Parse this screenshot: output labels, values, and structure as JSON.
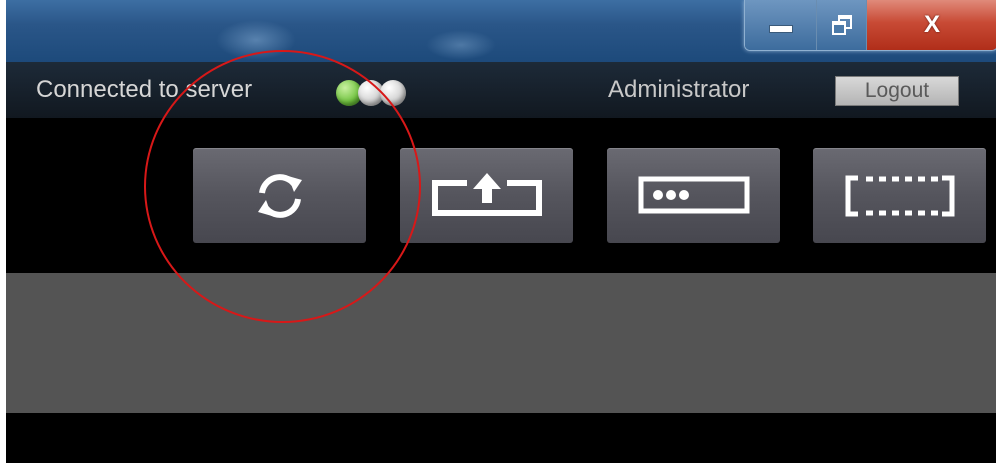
{
  "window": {
    "controls": {
      "minimize_icon": "minimize-icon",
      "restore_icon": "restore-icon",
      "close_label": "X"
    }
  },
  "status_bar": {
    "connection_text": "Connected to server",
    "indicators": [
      "green",
      "grey",
      "grey"
    ],
    "user_label": "Administrator",
    "logout_label": "Logout"
  },
  "toolbar": {
    "buttons": [
      {
        "icon": "refresh-icon"
      },
      {
        "icon": "upload-frame-icon"
      },
      {
        "icon": "dots-frame-icon"
      },
      {
        "icon": "dashed-frame-icon"
      }
    ]
  },
  "colors": {
    "titlebar": "#2a5688",
    "status_green": "#6fc23e",
    "status_grey": "#cfcfcf",
    "button_bg": "#55555d",
    "panel_bg": "#545454",
    "annotation": "#d81818"
  }
}
